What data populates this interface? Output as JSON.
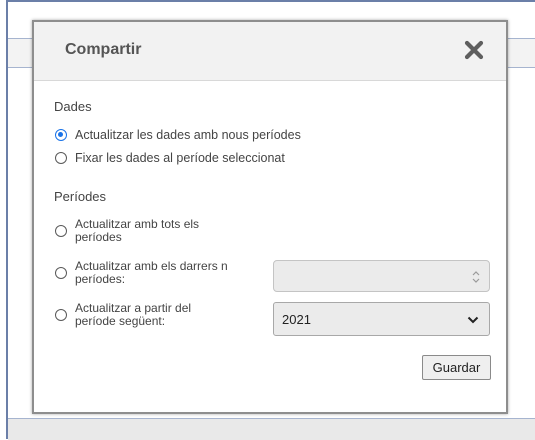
{
  "dialog": {
    "title": "Compartir",
    "close_icon": "close-icon"
  },
  "dades": {
    "label": "Dades",
    "options": [
      {
        "label": "Actualitzar les dades amb nous períodes",
        "checked": true
      },
      {
        "label": "Fixar les dades al període seleccionat",
        "checked": false
      }
    ]
  },
  "periodes": {
    "label": "Períodes",
    "options": [
      {
        "line1": "Actualitzar amb tots els",
        "line2": "períodes",
        "checked": false
      },
      {
        "line1": "Actualitzar amb els darrers n",
        "line2": "períodes:",
        "checked": false
      },
      {
        "line1": "Actualitzar a partir del",
        "line2": "període següent:",
        "checked": false
      }
    ],
    "n_value": "",
    "year_select": {
      "selected": "2021"
    }
  },
  "buttons": {
    "save_label": "Guardar"
  },
  "colors": {
    "accent": "#1a73e8",
    "header_bg": "#f2f2f2",
    "page_border": "#6b7fa8"
  }
}
